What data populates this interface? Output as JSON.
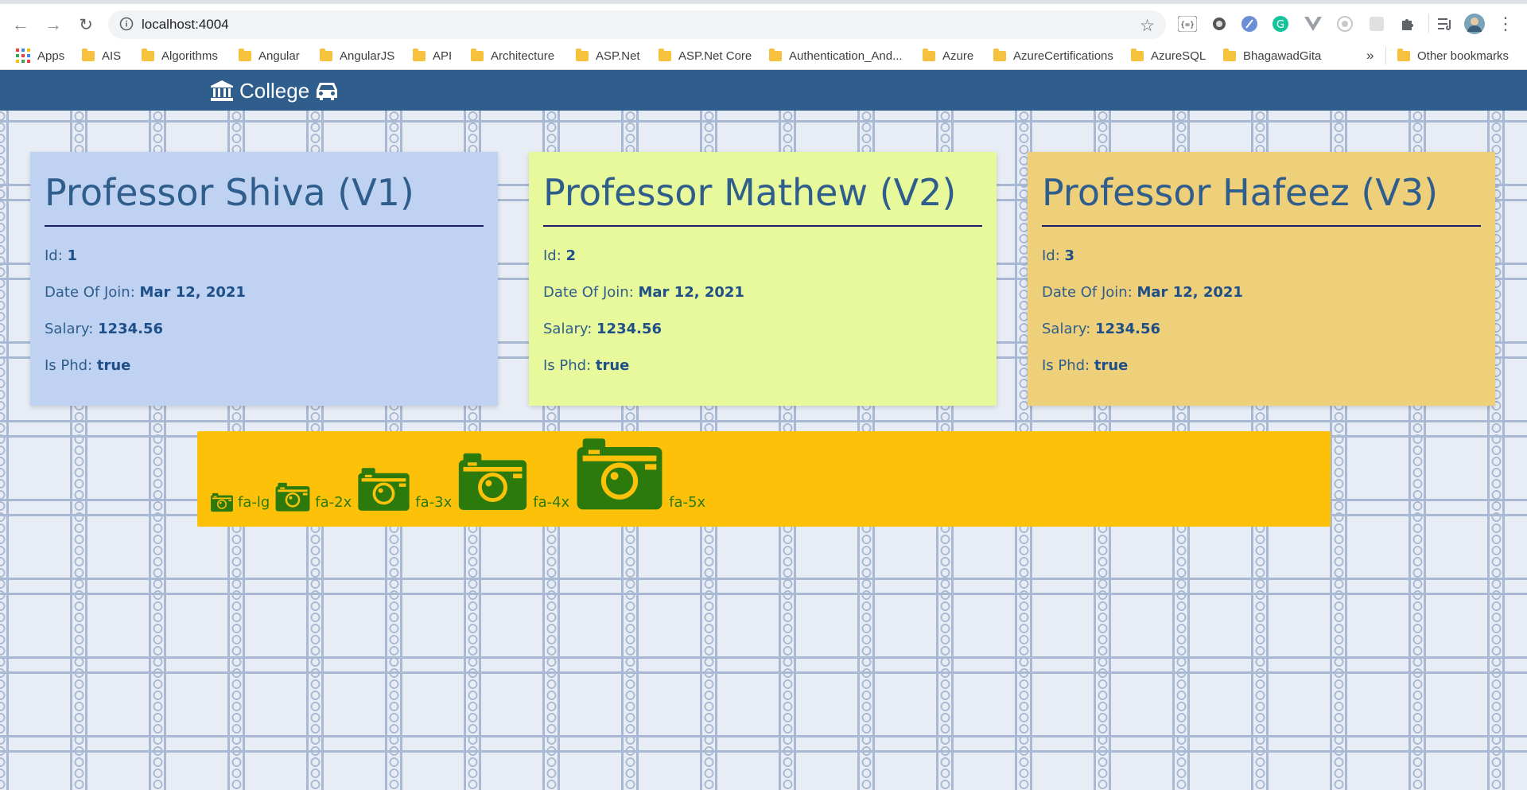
{
  "browser": {
    "url": "localhost:4004",
    "bookmarks": [
      "Apps",
      "AIS",
      "Algorithms",
      "Angular",
      "AngularJS",
      "API",
      "Architecture",
      "ASP.Net",
      "ASP.Net Core",
      "Authentication_And...",
      "Azure",
      "AzureCertifications",
      "AzureSQL",
      "BhagawadGita"
    ],
    "overflow": "»",
    "other_bookmarks": "Other bookmarks"
  },
  "navbar": {
    "brand": "College",
    "brand_left_icon": "university-icon",
    "brand_right_icon": "car-icon"
  },
  "cards": [
    {
      "title": "Professor Shiva (V1)",
      "bg": "#bfd2f2",
      "id_label": "Id: ",
      "id": "1",
      "doj_label": "Date Of Join: ",
      "doj": "Mar 12, 2021",
      "salary_label": "Salary: ",
      "salary": "1234.56",
      "phd_label": "Is Phd: ",
      "phd": "true"
    },
    {
      "title": "Professor Mathew (V2)",
      "bg": "#e7f99a",
      "id_label": "Id: ",
      "id": "2",
      "doj_label": "Date Of Join: ",
      "doj": "Mar 12, 2021",
      "salary_label": "Salary: ",
      "salary": "1234.56",
      "phd_label": "Is Phd: ",
      "phd": "true"
    },
    {
      "title": "Professor Hafeez (V3)",
      "bg": "#eecf7a",
      "id_label": "Id: ",
      "id": "3",
      "doj_label": "Date Of Join: ",
      "doj": "Mar 12, 2021",
      "salary_label": "Salary: ",
      "salary": "1234.56",
      "phd_label": "Is Phd: ",
      "phd": "true"
    }
  ],
  "icon_panel": {
    "bg": "#fdc10a",
    "icon_color": "#2b7a0b",
    "icon_name": "camera-icon",
    "items": [
      "fa-lg",
      "fa-2x",
      "fa-3x",
      "fa-4x",
      "fa-5x"
    ]
  }
}
